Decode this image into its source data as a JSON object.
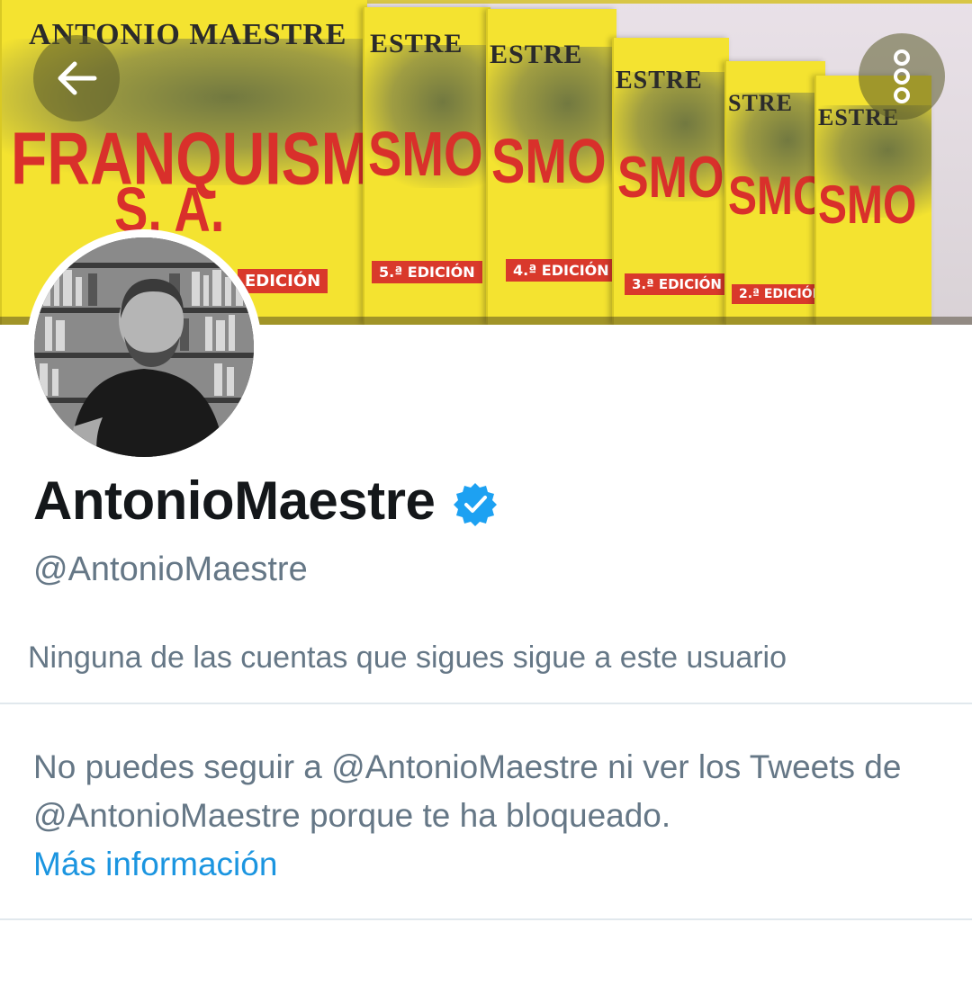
{
  "header": {
    "back_icon": "arrow-left-icon",
    "more_icon": "more-vertical-icon"
  },
  "banner": {
    "books": [
      {
        "author": "ANTONIO MAESTRE",
        "title": "FRANQUISMO",
        "subtitle": "S. A.",
        "edition": "EDICIÓN"
      },
      {
        "author": "ESTRE",
        "title": "SMO",
        "edition": "5.ª EDICIÓN"
      },
      {
        "author": "ESTRE",
        "title": "SMO",
        "edition": "4.ª EDICIÓN"
      },
      {
        "author": "ESTRE",
        "title": "SMO",
        "edition": "3.ª EDICIÓN"
      },
      {
        "author": "STRE",
        "title": "SMO",
        "edition": "2.ª EDICIÓN"
      },
      {
        "author": "ESTRE",
        "title": "SMO"
      }
    ]
  },
  "profile": {
    "display_name": "AntonioMaestre",
    "verified_icon": "verified-badge-icon",
    "handle": "@AntonioMaestre",
    "followers_note": "Ninguna de las cuentas que sigues sigue a este usuario"
  },
  "blocked": {
    "message": "No puedes seguir a @AntonioMaestre ni ver los Tweets de @AntonioMaestre porque te ha bloqueado.",
    "link": "Más información"
  },
  "colors": {
    "primary_text": "#14171a",
    "secondary_text": "#657786",
    "link": "#1b95e0",
    "verified": "#1da1f2",
    "divider": "#e1e8ed",
    "book_yellow": "#f4e330",
    "book_red": "#d9302b"
  }
}
